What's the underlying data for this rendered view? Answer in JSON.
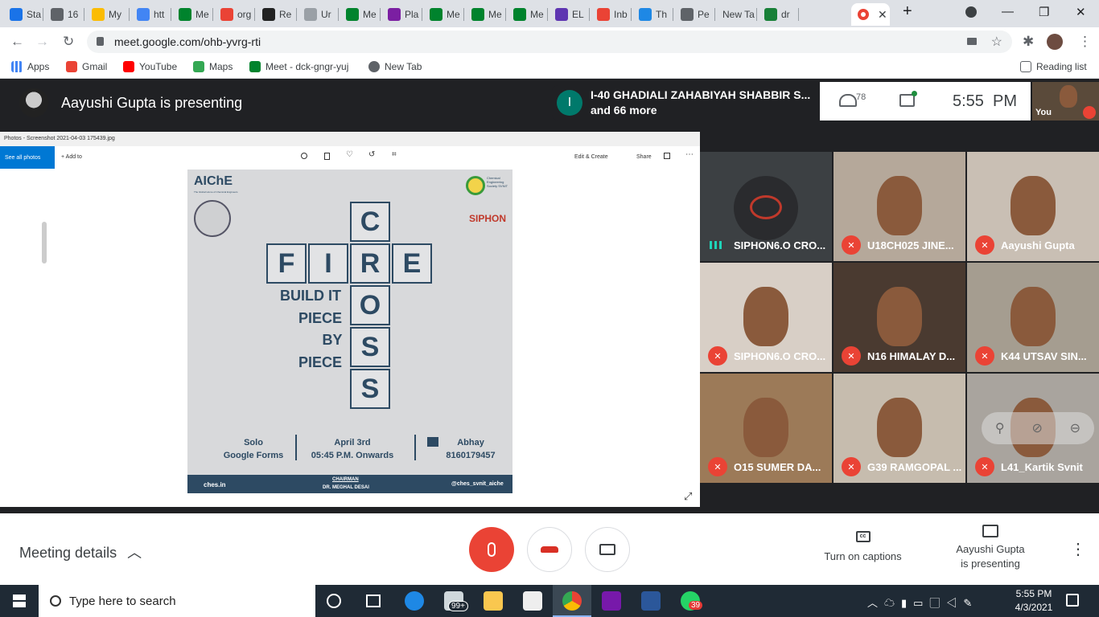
{
  "tabs": [
    {
      "label": "Sta",
      "color": "#1a73e8"
    },
    {
      "label": "16",
      "color": "#5f6368"
    },
    {
      "label": "My",
      "color": "#fbbc04"
    },
    {
      "label": "htt",
      "color": "#4285f4"
    },
    {
      "label": "Me",
      "color": "#00832d"
    },
    {
      "label": "org",
      "color": "#ea4335"
    },
    {
      "label": "Re",
      "color": "#222222"
    },
    {
      "label": "Ur",
      "color": "#9aa0a6"
    },
    {
      "label": "Me",
      "color": "#00832d"
    },
    {
      "label": "Pla",
      "color": "#7b1fa2"
    },
    {
      "label": "Me",
      "color": "#00832d"
    },
    {
      "label": "Me",
      "color": "#00832d"
    },
    {
      "label": "Me",
      "color": "#00832d"
    },
    {
      "label": "EL",
      "color": "#5e35b1"
    },
    {
      "label": "Inb",
      "color": "#ea4335"
    },
    {
      "label": "Th",
      "color": "#1e88e5"
    },
    {
      "label": "Pe",
      "color": "#5f6368"
    },
    {
      "label": "New Ta",
      "color": "#ffffff"
    },
    {
      "label": "dr",
      "color": "#188038"
    }
  ],
  "url": "meet.google.com/ohb-yvrg-rti",
  "bookmarks": [
    "Apps",
    "Gmail",
    "YouTube",
    "Maps",
    "Meet - dck-gngr-yuj",
    "New Tab"
  ],
  "reading_list": "Reading list",
  "presenter_banner": "Aayushi Gupta is presenting",
  "notification": {
    "initial": "I",
    "line1": "I-40 GHADIALI ZAHABIYAH SHABBIR S...",
    "line2": "and 66 more"
  },
  "participant_count": "78",
  "clock": "5:55  PM",
  "self_label": "You",
  "photos": {
    "title": "Photos - Screenshot 2021-04-03 175439.jpg",
    "see_all": "See all photos",
    "add_to": "+ Add to",
    "edit_create": "Edit & Create",
    "share": "Share"
  },
  "poster": {
    "org": "AIChE",
    "org_sub": "The Global Home of Chemical Engineers",
    "society": "Chemical Engineering Society SVNIT",
    "siphon": "SIPHON",
    "cross_letters": [
      "C",
      "R",
      "O",
      "S",
      "S"
    ],
    "fire_letters": [
      "F",
      "I",
      "R",
      "E"
    ],
    "tagline": [
      "BUILD IT",
      "PIECE",
      "BY",
      "PIECE"
    ],
    "col1": [
      "Solo",
      "Google Forms"
    ],
    "col2": [
      "April 3rd",
      "05:45 P.M. Onwards"
    ],
    "col3": [
      "Abhay",
      "8160179457"
    ],
    "foot_left": "ches.in",
    "foot_mid1": "CHAIRMAN",
    "foot_mid2": "DR. MEGHAL DESAI",
    "foot_right": "@ches_svnit_aiche"
  },
  "participants": [
    {
      "name": "SIPHON6.O CRO...",
      "speaking": true,
      "bg": "#3c4043"
    },
    {
      "name": "U18CH025 JINE...",
      "speaking": false,
      "bg": "#b5a89a"
    },
    {
      "name": "Aayushi Gupta",
      "speaking": false,
      "bg": "#c9bfb4"
    },
    {
      "name": "SIPHON6.O CRO...",
      "speaking": false,
      "bg": "#d8cfc6"
    },
    {
      "name": "N16 HIMALAY D...",
      "speaking": false,
      "bg": "#4a3a30"
    },
    {
      "name": "K44 UTSAV SIN...",
      "speaking": false,
      "bg": "#a59d90"
    },
    {
      "name": "O15 SUMER DA...",
      "speaking": false,
      "bg": "#9c7a58"
    },
    {
      "name": "G39 RAMGOPAL ...",
      "speaking": false,
      "bg": "#c6bcae"
    },
    {
      "name": "L41_Kartik Svnit",
      "speaking": false,
      "bg": "#a9a49e"
    }
  ],
  "controls": {
    "meeting_details": "Meeting details",
    "captions": "Turn on captions",
    "presenting1": "Aayushi Gupta",
    "presenting2": "is presenting"
  },
  "taskbar": {
    "search_placeholder": "Type here to search",
    "time": "5:55 PM",
    "date": "4/3/2021",
    "mail_badge": "99+",
    "whatsapp_badge": "39"
  }
}
